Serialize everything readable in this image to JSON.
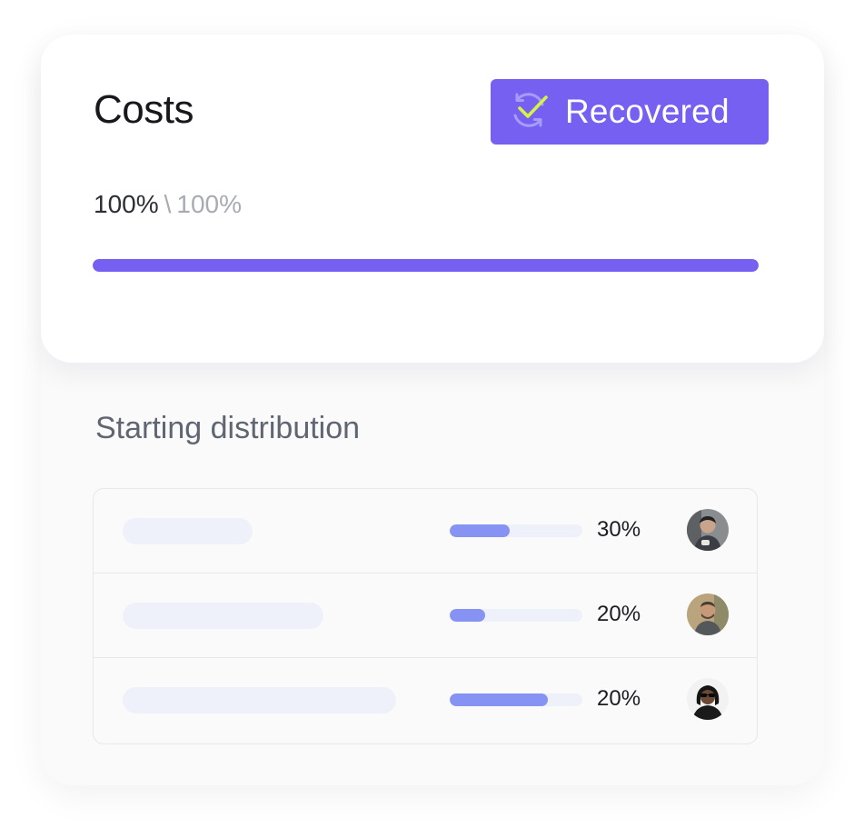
{
  "costs": {
    "title": "Costs",
    "badge": {
      "icon": "check-sync-icon",
      "label": "Recovered"
    },
    "progress": {
      "current": "100%",
      "separator": "\\",
      "total": "100%",
      "fraction": 1.0
    }
  },
  "distribution": {
    "title": "Starting distribution",
    "rows": [
      {
        "share": "30%",
        "bar_fraction": 0.45,
        "name_placeholder_width": 143,
        "avatar": "avatar-1"
      },
      {
        "share": "20%",
        "bar_fraction": 0.27,
        "name_placeholder_width": 221,
        "avatar": "avatar-2"
      },
      {
        "share": "20%",
        "bar_fraction": 0.74,
        "name_placeholder_width": 301,
        "avatar": "avatar-3"
      }
    ]
  },
  "colors": {
    "accent": "#7660f2",
    "bar": "#8793f3",
    "check": "#d8f244",
    "muted": "#a9abb4"
  }
}
